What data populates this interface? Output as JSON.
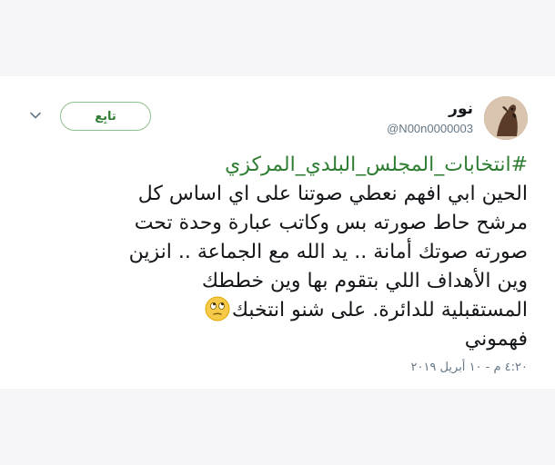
{
  "tweet": {
    "author_name": "نور",
    "author_handle": "@N00n0000003",
    "follow_label": "تابِع",
    "hashtag": "#انتخابات_المجلس_البلدي_المركزي",
    "lines": [
      "الحين ابي افهم نعطي صوتنا على اي اساس كل",
      "مرشح حاط صورته بس وكاتب عبارة وحدة تحت",
      "صورته صوتك أمانة  .. يد الله مع الجماعة .. انزين",
      "وين الأهداف اللي بتقوم بها وين خططك",
      "المستقبلية للدائرة.  على شنو  انتخبك",
      "فهموني"
    ],
    "timestamp": "٤:٢٠ م - ١٠ أبريل ٢٠١٩"
  },
  "icons": {
    "avatar": "horse-avatar-icon",
    "menu": "chevron-down-icon",
    "emoji": "rolling-eyes-emoji-icon"
  },
  "colors": {
    "hashtag": "#2e7d32",
    "follow_border": "#8fbf8f",
    "text": "#14171a",
    "muted": "#657786"
  }
}
